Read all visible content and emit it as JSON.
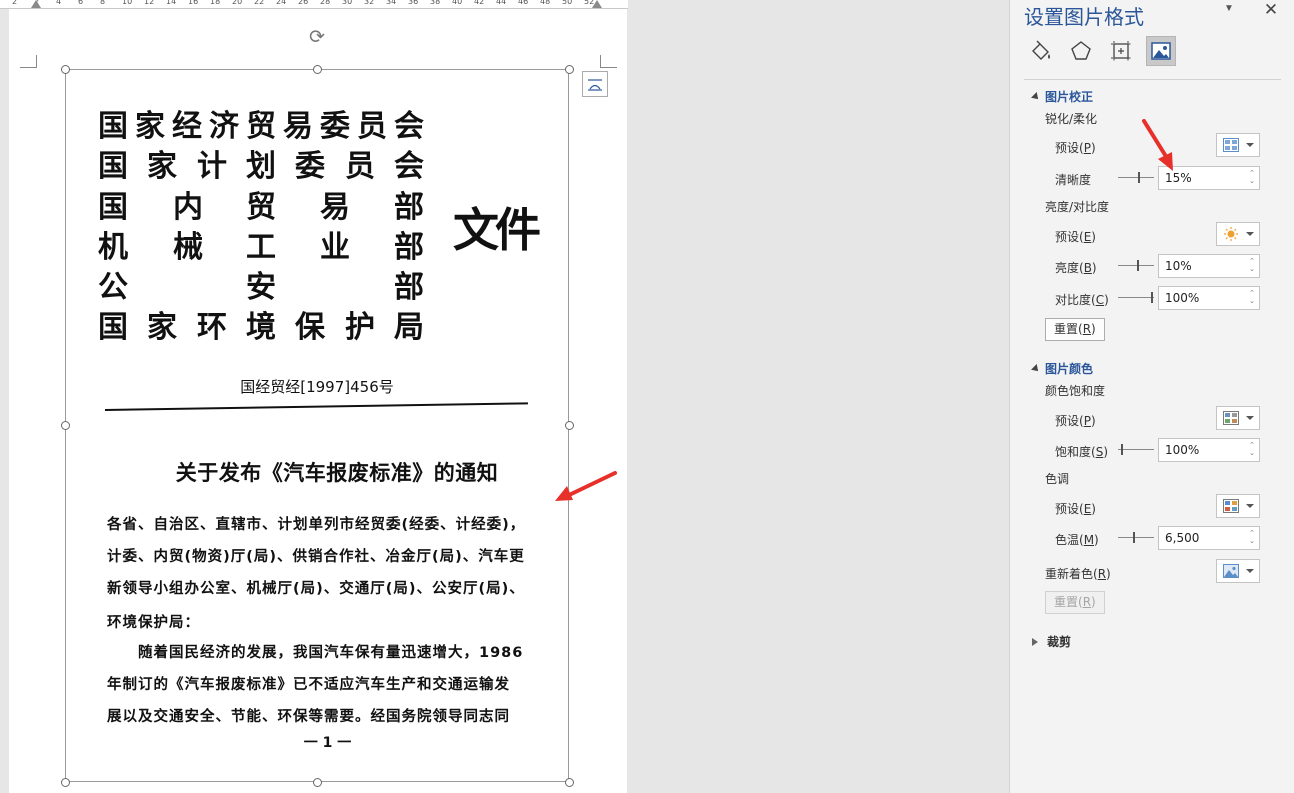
{
  "ruler": {
    "numbers": [
      "2",
      "2",
      "4",
      "6",
      "8",
      "10",
      "12",
      "14",
      "16",
      "18",
      "20",
      "22",
      "24",
      "26",
      "28",
      "30",
      "32",
      "34",
      "36",
      "38",
      "40",
      "42",
      "44",
      "46",
      "48",
      "50",
      "52"
    ]
  },
  "document": {
    "org_rows": [
      [
        "国",
        "家",
        "经",
        "济",
        "贸",
        "易",
        "委",
        "员",
        "会"
      ],
      [
        "国",
        "家",
        "计",
        "划",
        "委",
        "员",
        "会"
      ],
      [
        "国",
        "内",
        "贸",
        "易",
        "部"
      ],
      [
        "机",
        "械",
        "工",
        "业",
        "部"
      ],
      [
        "公",
        "安",
        "部"
      ],
      [
        "国",
        "家",
        "环",
        "境",
        "保",
        "护",
        "局"
      ]
    ],
    "wenjian": "文件",
    "doc_number": "国经贸经[1997]456号",
    "notice_title": "关于发布《汽车报废标准》的通知",
    "body_lines": [
      "各省、自治区、直辖市、计划单列市经贸委(经委、计经委)，",
      "计委、内贸(物资)厅(局)、供销合作社、冶金厅(局)、汽车更",
      "新领导小组办公室、机械厅(局)、交通厅(局)、公安厅(局)、",
      "环境保护局：",
      "　　随着国民经济的发展，我国汽车保有量迅速增大，1986",
      "年制订的《汽车报废标准》已不适应汽车生产和交通运输发",
      "展以及交通安全、节能、环保等需要。经国务院领导同志同"
    ],
    "page_number": "一 1 一"
  },
  "pane": {
    "title": "设置图片格式",
    "tabs": [
      "fill-line-icon",
      "effects-icon",
      "size-layout-icon",
      "picture-icon"
    ],
    "active_tab": "picture-icon",
    "correction": {
      "heading": "图片校正",
      "sharpen_heading": "锐化/柔化",
      "preset_label": "预设(",
      "preset_key": "P",
      "sharpness_label": "清晰度",
      "sharpness_value": "15%",
      "bc_heading": "亮度/对比度",
      "bc_preset_label": "预设(",
      "bc_preset_key": "E",
      "brightness_label": "亮度(",
      "brightness_key": "B",
      "brightness_value": "10%",
      "contrast_label": "对比度(",
      "contrast_key": "C",
      "contrast_value": "100%",
      "reset_label": "重置(",
      "reset_key": "R"
    },
    "color": {
      "heading": "图片颜色",
      "saturation_heading": "颜色饱和度",
      "sat_preset_label": "预设(",
      "sat_preset_key": "P",
      "saturation_label": "饱和度(",
      "saturation_key": "S",
      "saturation_value": "100%",
      "tone_heading": "色调",
      "tone_preset_label": "预设(",
      "tone_preset_key": "E",
      "temperature_label": "色温(",
      "temperature_key": "M",
      "temperature_value": "6,500",
      "recolor_label": "重新着色(",
      "recolor_key": "R",
      "reset_label": "重置(",
      "reset_key": "R"
    },
    "crop": {
      "heading": "裁剪"
    }
  },
  "colors": {
    "accent": "#2b579a",
    "arrow": "#e8302a"
  }
}
